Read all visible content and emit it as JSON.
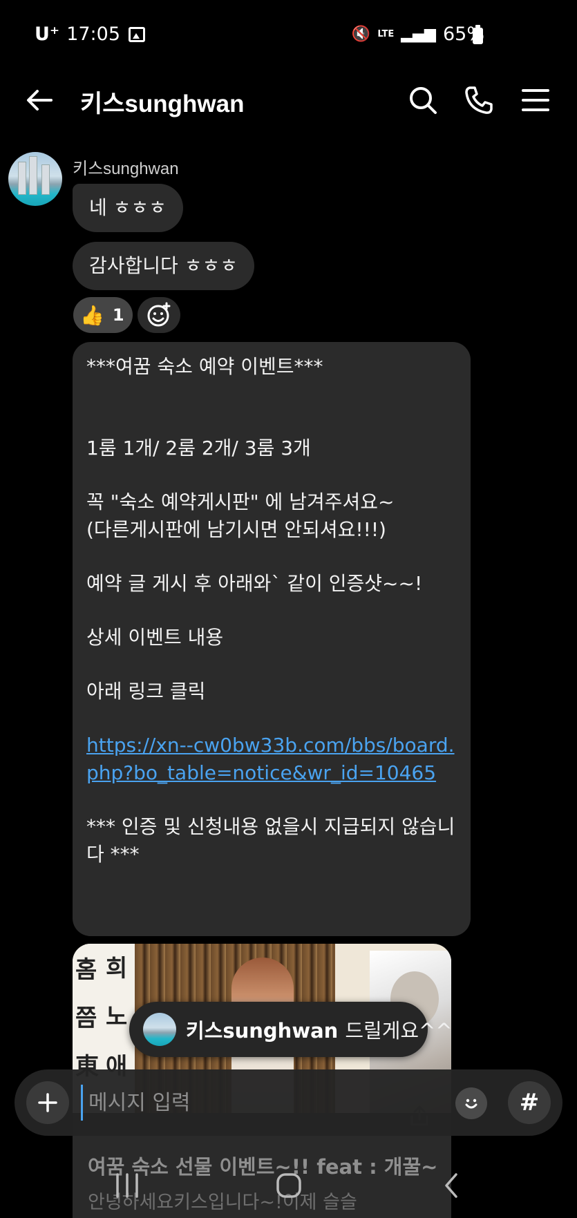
{
  "status_bar": {
    "carrier": "U⁺",
    "time": "17:05",
    "battery": "65%",
    "network": "LTE",
    "icons": [
      "gallery-icon",
      "mute-icon",
      "lte-icon",
      "signal-icon",
      "battery-icon"
    ]
  },
  "header": {
    "title": "키스sunghwan",
    "icons": [
      "back-arrow-icon",
      "search-icon",
      "phone-icon",
      "menu-icon"
    ]
  },
  "conversation": {
    "sender_name": "키스sunghwan",
    "messages": [
      {
        "text": "네 ㅎㅎㅎ"
      },
      {
        "text": "감사합니다 ㅎㅎㅎ"
      }
    ],
    "reaction": {
      "emoji": "👍",
      "count": "1"
    },
    "long_message": {
      "line1": "***여꿈 숙소 예약 이벤트***",
      "line2": "1룸 1개/ 2룸 2개/ 3룸 3개",
      "line3": "꼭  \"숙소 예약게시판\" 에 남겨주셔요~",
      "line4": "(다른게시판에 남기시면 안되셔요!!!)",
      "line5": "예약 글 게시 후 아래와` 같이 인증샷~~!",
      "line6": "상세 이벤트 내용",
      "line7": "아래 링크 클릭",
      "link": "https://xn--cw0bw33b.com/bbs/board.php?bo_table=notice&wr_id=10465",
      "line8": "*** 인증 및 신청내용 없을시 지급되지 않습니다 ***"
    },
    "link_card": {
      "title": "여꿈 숙소 선물 이벤트~!! feat : 개꿀~",
      "description": "안녕하세요키스입니다~!이제 슬슬"
    }
  },
  "reply_toast": {
    "name": "키스sunghwan",
    "message": "드릴게요^^"
  },
  "composer": {
    "placeholder": "메시지 입력",
    "hash_label": "#"
  },
  "nav_bar": {
    "icons": [
      "recent-apps-icon",
      "home-icon",
      "back-icon"
    ]
  }
}
